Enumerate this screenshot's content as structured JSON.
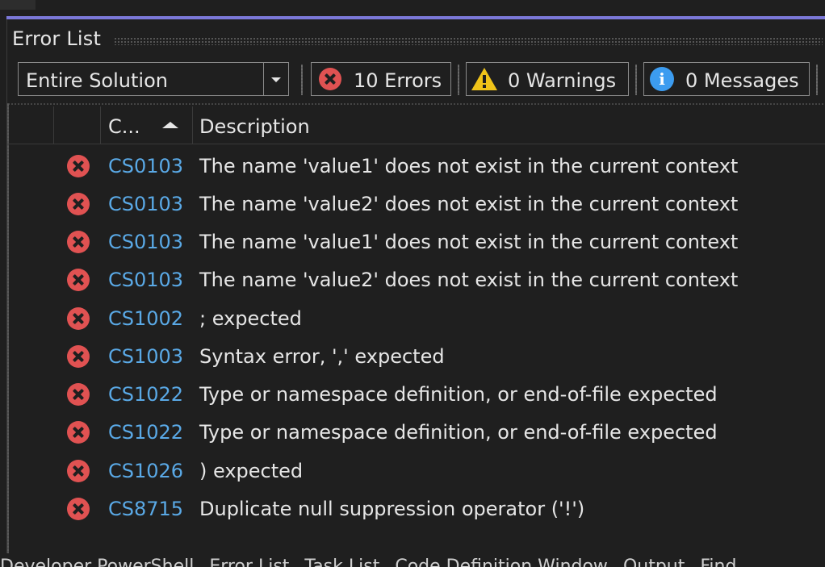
{
  "panel": {
    "title": "Error List"
  },
  "toolbar": {
    "scope_value": "Entire Solution",
    "errors_label": "10 Errors",
    "warnings_label": "0 Warnings",
    "messages_label": "0 Messages"
  },
  "columns": {
    "code": "C...",
    "description": "Description"
  },
  "rows": [
    {
      "code": "CS0103",
      "description": "The name 'value1' does not exist in the current context"
    },
    {
      "code": "CS0103",
      "description": "The name 'value2' does not exist in the current context"
    },
    {
      "code": "CS0103",
      "description": "The name 'value1' does not exist in the current context"
    },
    {
      "code": "CS0103",
      "description": "The name 'value2' does not exist in the current context"
    },
    {
      "code": "CS1002",
      "description": "; expected"
    },
    {
      "code": "CS1003",
      "description": "Syntax error, ',' expected"
    },
    {
      "code": "CS1022",
      "description": "Type or namespace definition, or end-of-file expected"
    },
    {
      "code": "CS1022",
      "description": "Type or namespace definition, or end-of-file expected"
    },
    {
      "code": "CS1026",
      "description": ") expected"
    },
    {
      "code": "CS8715",
      "description": "Duplicate null suppression operator ('!')"
    }
  ],
  "bottom_tabs": [
    "Developer PowerShell",
    "Error List",
    "Task List",
    "Code Definition Window",
    "Output",
    "Find"
  ],
  "icons": {
    "error": "error-circle-x-icon",
    "warning": "warning-triangle-icon",
    "info": "info-circle-icon"
  },
  "colors": {
    "accent": "#7b78d8",
    "error": "#e05252",
    "warning": "#f0c419",
    "info": "#3c9cf0",
    "code_link": "#5aa9e6"
  }
}
